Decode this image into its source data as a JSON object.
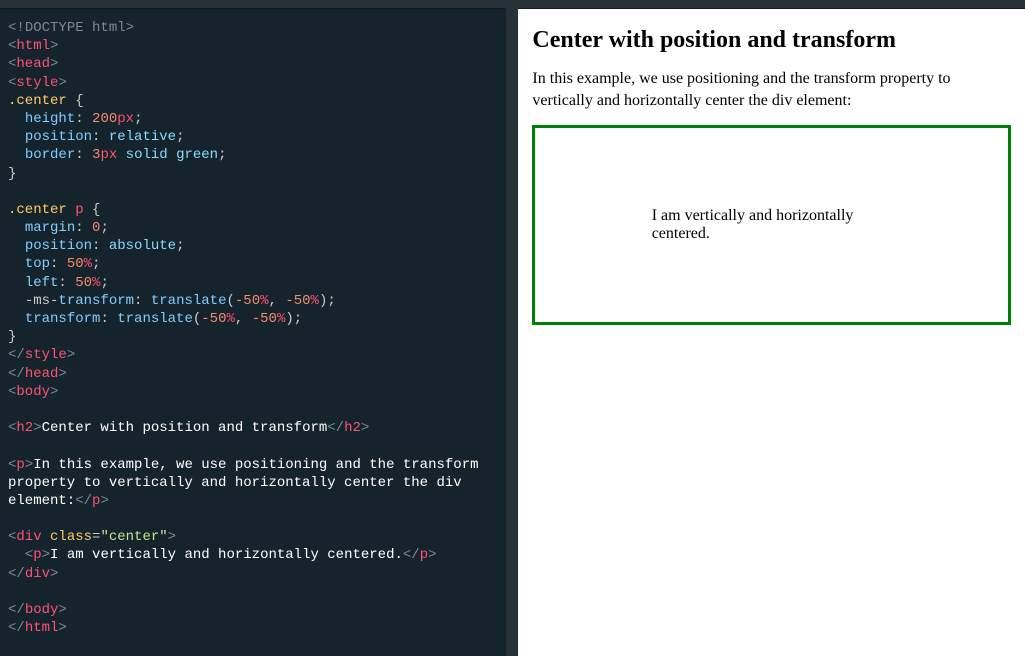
{
  "preview": {
    "heading": "Center with position and transform",
    "description": "In this example, we use positioning and the transform property to vertically and horizontally center the div element:",
    "centered_text": "I am vertically and horizontally centered."
  },
  "code": {
    "l1a": "<!",
    "l1b": "DOCTYPE",
    "l1c": " html",
    "l1d": ">",
    "l2a": "<",
    "l2b": "html",
    "l2c": ">",
    "l3a": "<",
    "l3b": "head",
    "l3c": ">",
    "l4a": "<",
    "l4b": "style",
    "l4c": ">",
    "l5a": ".center",
    "l5b": " {",
    "l6a": "  height",
    "l6b": ": ",
    "l6c": "200",
    "l6d": "px",
    "l6e": ";",
    "l7a": "  position",
    "l7b": ": ",
    "l7c": "relative",
    "l7d": ";",
    "l8a": "  border",
    "l8b": ": ",
    "l8c": "3",
    "l8d": "px",
    "l8e": " solid ",
    "l8f": "green",
    "l8g": ";",
    "l9": "}",
    "l11a": ".center",
    "l11b": " p",
    "l11c": " {",
    "l12a": "  margin",
    "l12b": ": ",
    "l12c": "0",
    "l12d": ";",
    "l13a": "  position",
    "l13b": ": ",
    "l13c": "absolute",
    "l13d": ";",
    "l14a": "  top",
    "l14b": ": ",
    "l14c": "50",
    "l14d": "%",
    "l14e": ";",
    "l15a": "  left",
    "l15b": ": ",
    "l15c": "50",
    "l15d": "%",
    "l15e": ";",
    "l16a": "  -ms-",
    "l16b": "transform",
    "l16c": ": ",
    "l16d": "translate",
    "l16e": "(",
    "l16f": "-50",
    "l16g": "%",
    "l16h": ", ",
    "l16i": "-50",
    "l16j": "%",
    "l16k": ")",
    "l16l": ";",
    "l17a": "  transform",
    "l17b": ": ",
    "l17c": "translate",
    "l17d": "(",
    "l17e": "-50",
    "l17f": "%",
    "l17g": ", ",
    "l17h": "-50",
    "l17i": "%",
    "l17j": ")",
    "l17k": ";",
    "l18": "}",
    "l19a": "</",
    "l19b": "style",
    "l19c": ">",
    "l20a": "</",
    "l20b": "head",
    "l20c": ">",
    "l21a": "<",
    "l21b": "body",
    "l21c": ">",
    "l23a": "<",
    "l23b": "h2",
    "l23c": ">",
    "l23d": "Center with position and transform",
    "l23e": "</",
    "l23f": "h2",
    "l23g": ">",
    "l25a": "<",
    "l25b": "p",
    "l25c": ">",
    "l25d": "In this example, we use positioning and the transform property to vertically and horizontally center the div element:",
    "l25e": "</",
    "l25f": "p",
    "l25g": ">",
    "l27a": "<",
    "l27b": "div",
    "l27c": " ",
    "l27d": "class",
    "l27e": "=",
    "l27f": "\"center\"",
    "l27g": ">",
    "l28a": "  <",
    "l28b": "p",
    "l28c": ">",
    "l28d": "I am vertically and horizontally centered.",
    "l28e": "</",
    "l28f": "p",
    "l28g": ">",
    "l29a": "</",
    "l29b": "div",
    "l29c": ">",
    "l31a": "</",
    "l31b": "body",
    "l31c": ">",
    "l32a": "</",
    "l32b": "html",
    "l32c": ">"
  }
}
